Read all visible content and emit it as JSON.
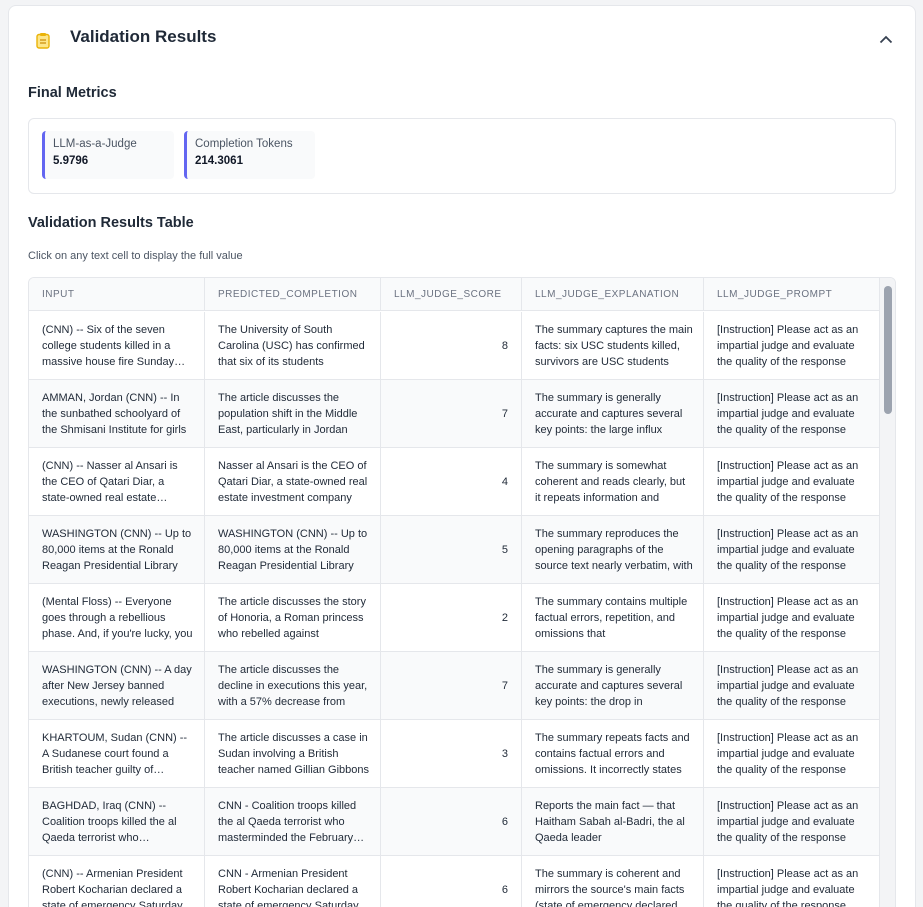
{
  "panel": {
    "title": "Validation Results",
    "icon": "clipboard-icon",
    "collapse_icon": "chevron-up-icon"
  },
  "metrics": {
    "title": "Final Metrics",
    "items": [
      {
        "label": "LLM-as-a-Judge",
        "value": "5.9796"
      },
      {
        "label": "Completion Tokens",
        "value": "214.3061"
      }
    ]
  },
  "table": {
    "title": "Validation Results Table",
    "hint": "Click on any text cell to display the full value",
    "columns": [
      "INPUT",
      "PREDICTED_COMPLETION",
      "LLM_JUDGE_SCORE",
      "LLM_JUDGE_EXPLANATION",
      "LLM_JUDGE_PROMPT"
    ],
    "rows": [
      {
        "input": "(CNN) -- Six of the seven college students killed in a massive house fire Sunday morning",
        "completion": "The University of South Carolina (USC) has confirmed that six of its students",
        "score": "8",
        "explanation": "The summary captures the main facts: six USC students killed, survivors are USC students",
        "prompt": "[Instruction] Please act as an impartial judge and evaluate the quality of the response"
      },
      {
        "input": "AMMAN, Jordan (CNN) -- In the sunbathed schoolyard of the Shmisani Institute for girls",
        "completion": "The article discusses the population shift in the Middle East, particularly in Jordan",
        "score": "7",
        "explanation": "The summary is generally accurate and captures several key points: the large influx",
        "prompt": "[Instruction] Please act as an impartial judge and evaluate the quality of the response"
      },
      {
        "input": "(CNN) -- Nasser al Ansari is the CEO of Qatari Diar, a state-owned real estate company",
        "completion": "Nasser al Ansari is the CEO of Qatari Diar, a state-owned real estate investment company",
        "score": "4",
        "explanation": "The summary is somewhat coherent and reads clearly, but it repeats information and",
        "prompt": "[Instruction] Please act as an impartial judge and evaluate the quality of the response"
      },
      {
        "input": "WASHINGTON (CNN) -- Up to 80,000 items at the Ronald Reagan Presidential Library",
        "completion": "WASHINGTON (CNN) -- Up to 80,000 items at the Ronald Reagan Presidential Library",
        "score": "5",
        "explanation": "The summary reproduces the opening paragraphs of the source text nearly verbatim, with",
        "prompt": "[Instruction] Please act as an impartial judge and evaluate the quality of the response"
      },
      {
        "input": "(Mental Floss) -- Everyone goes through a rebellious phase. And, if you're lucky, you",
        "completion": "The article discusses the story of Honoria, a Roman princess who rebelled against",
        "score": "2",
        "explanation": "The summary contains multiple factual errors, repetition, and omissions that",
        "prompt": "[Instruction] Please act as an impartial judge and evaluate the quality of the response"
      },
      {
        "input": "WASHINGTON (CNN) -- A day after New Jersey banned executions, newly released",
        "completion": "The article discusses the decline in executions this year, with a 57% decrease from",
        "score": "7",
        "explanation": "The summary is generally accurate and captures several key points: the drop in",
        "prompt": "[Instruction] Please act as an impartial judge and evaluate the quality of the response"
      },
      {
        "input": "KHARTOUM, Sudan (CNN) -- A Sudanese court found a British teacher guilty of insulting",
        "completion": "The article discusses a case in Sudan involving a British teacher named Gillian Gibbons",
        "score": "3",
        "explanation": "The summary repeats facts and contains factual errors and omissions. It incorrectly states",
        "prompt": "[Instruction] Please act as an impartial judge and evaluate the quality of the response"
      },
      {
        "input": "BAGHDAD, Iraq (CNN) -- Coalition troops killed the al Qaeda terrorist who masterminded",
        "completion": "CNN - Coalition troops killed the al Qaeda terrorist who masterminded the February attack",
        "score": "6",
        "explanation": "Reports the main fact — that Haitham Sabah al-Badri, the al Qaeda leader",
        "prompt": "[Instruction] Please act as an impartial judge and evaluate the quality of the response"
      },
      {
        "input": "(CNN) -- Armenian President Robert Kocharian declared a state of emergency Saturday",
        "completion": "CNN - Armenian President Robert Kocharian declared a state of emergency Saturday night",
        "score": "6",
        "explanation": "The summary is coherent and mirrors the source's main facts (state of emergency declared",
        "prompt": "[Instruction] Please act as an impartial judge and evaluate the quality of the response"
      }
    ]
  }
}
